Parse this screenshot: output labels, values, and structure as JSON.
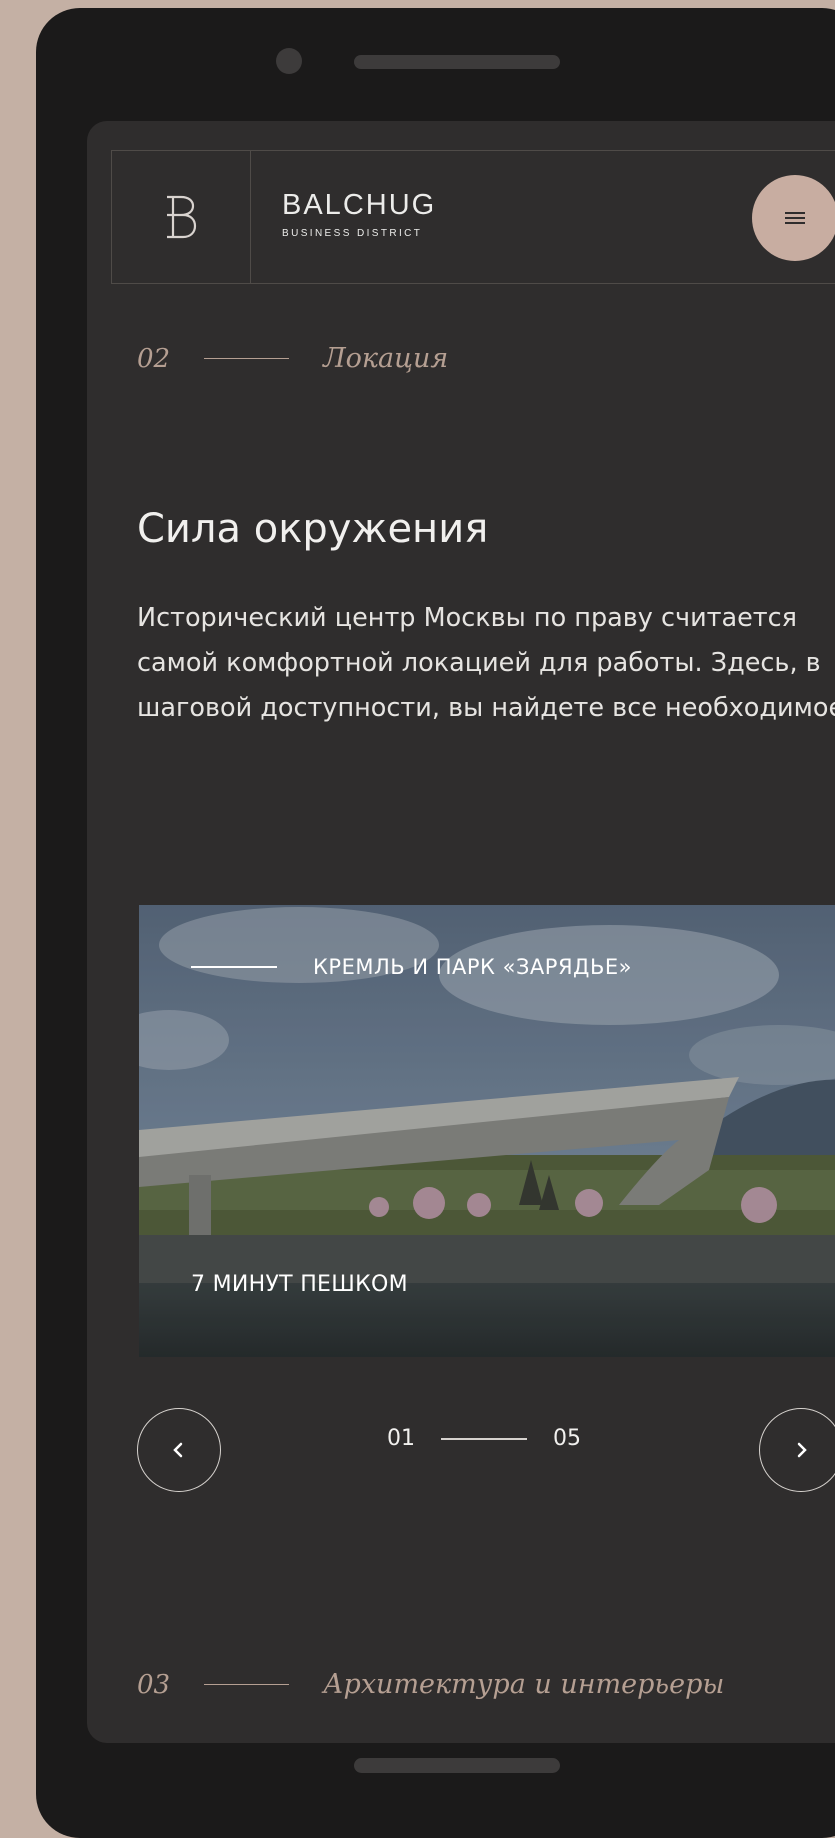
{
  "header": {
    "brand_name": "BALCHUG",
    "brand_sub": "BUSINESS DISTRICT",
    "logo_letter": "B",
    "menu_icon": "hamburger-icon"
  },
  "section_current": {
    "number": "02",
    "title": "Локация"
  },
  "heading": "Сила окружения",
  "lead": "Исторический центр Москвы по праву считается самой комфортной локацией для работы. Здесь, в шаговой доступности, вы найдете все необходимое.",
  "slide": {
    "title": "КРЕМЛЬ И ПАРК «ЗАРЯДЬЕ»",
    "caption": "7 МИНУТ ПЕШКОМ"
  },
  "pager": {
    "current": "01",
    "total": "05",
    "prev_icon": "chevron-left-icon",
    "next_icon": "chevron-right-icon"
  },
  "section_next": {
    "number": "03",
    "title": "Архитектура и интерьеры"
  },
  "colors": {
    "accent": "#c8ada1",
    "background": "#2f2d2d",
    "label": "#b59f92"
  }
}
